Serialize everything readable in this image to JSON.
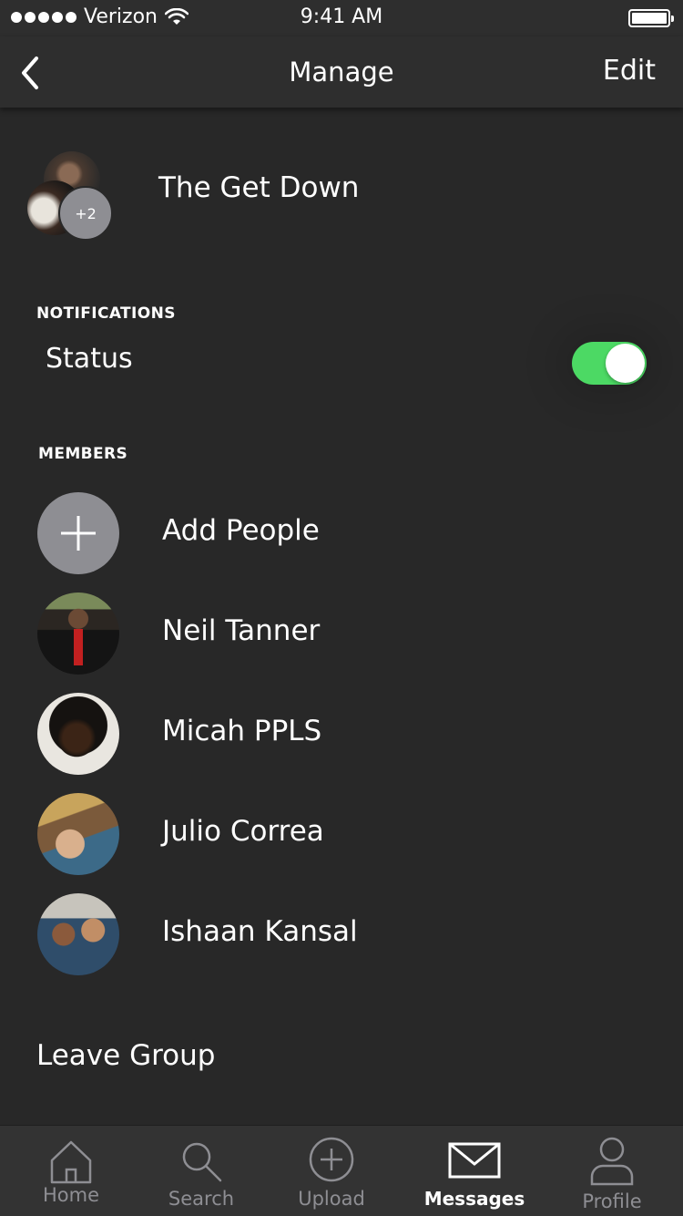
{
  "status_bar": {
    "carrier": "Verizon",
    "time": "9:41 AM",
    "signal_icon": "signal-dots-icon",
    "wifi_icon": "wifi-icon",
    "battery_icon": "battery-icon"
  },
  "nav": {
    "back_icon": "chevron-left-icon",
    "title": "Manage",
    "edit_label": "Edit"
  },
  "group": {
    "name": "The Get Down",
    "extra_members_badge": "+2"
  },
  "notifications": {
    "section_label": "NOTIFICATIONS",
    "status_label": "Status",
    "status_enabled": true,
    "toggle_color": "#4cd964"
  },
  "members": {
    "section_label": "MEMBERS",
    "add_label": "Add People",
    "add_icon": "plus-icon",
    "list": [
      {
        "name": "Neil Tanner"
      },
      {
        "name": "Micah PPLS"
      },
      {
        "name": "Julio Correa"
      },
      {
        "name": "Ishaan Kansal"
      }
    ]
  },
  "leave_group_label": "Leave Group",
  "tabs": [
    {
      "label": "Home",
      "icon": "home-icon",
      "active": false
    },
    {
      "label": "Search",
      "icon": "search-icon",
      "active": false
    },
    {
      "label": "Upload",
      "icon": "upload-plus-icon",
      "active": false
    },
    {
      "label": "Messages",
      "icon": "envelope-icon",
      "active": true
    },
    {
      "label": "Profile",
      "icon": "profile-icon",
      "active": false
    }
  ]
}
